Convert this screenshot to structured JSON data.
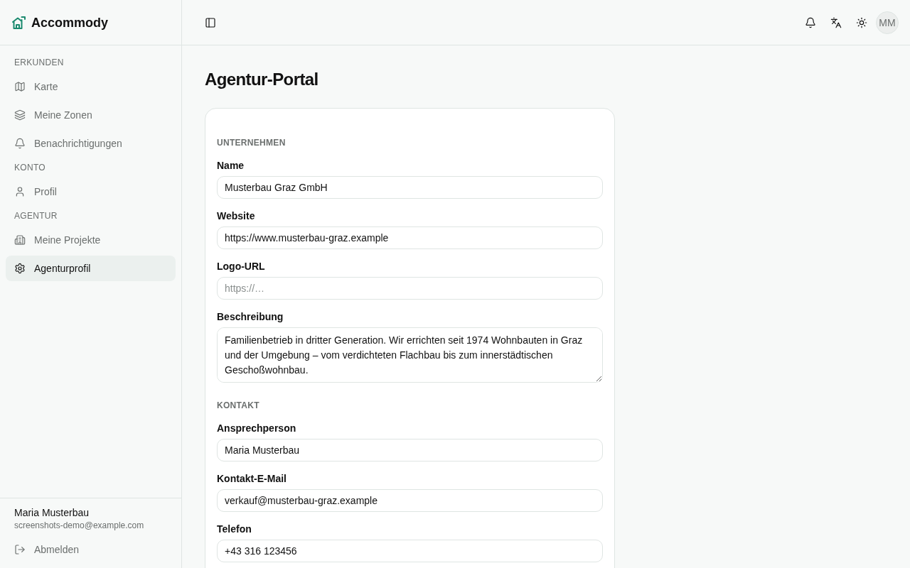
{
  "app": {
    "name": "Accommody"
  },
  "sidebar": {
    "sections": [
      {
        "title": "ERKUNDEN",
        "items": [
          {
            "label": "Karte",
            "selected": false
          },
          {
            "label": "Meine Zonen",
            "selected": false
          },
          {
            "label": "Benachrichtigungen",
            "selected": false
          }
        ]
      },
      {
        "title": "KONTO",
        "items": [
          {
            "label": "Profil",
            "selected": false
          }
        ]
      },
      {
        "title": "AGENTUR",
        "items": [
          {
            "label": "Meine Projekte",
            "selected": false
          },
          {
            "label": "Agenturprofil",
            "selected": true
          }
        ]
      }
    ],
    "user": {
      "name": "Maria Musterbau",
      "email": "screenshots-demo@example.com"
    },
    "logout": "Abmelden"
  },
  "header": {
    "avatar": "MM"
  },
  "page": {
    "title": "Agentur-Portal",
    "sections": [
      {
        "title": "UNTERNEHMEN",
        "fields": [
          {
            "kind": "input",
            "label": "Name",
            "value": "Musterbau Graz GmbH"
          },
          {
            "kind": "input",
            "label": "Website",
            "value": "https://www.musterbau-graz.example"
          },
          {
            "kind": "input",
            "label": "Logo-URL",
            "placeholder": "https://…"
          },
          {
            "kind": "textarea",
            "label": "Beschreibung",
            "value": "Familienbetrieb in dritter Generation. Wir errichten seit 1974 Wohnbauten in Graz und der Umgebung – vom verdichteten Flachbau bis zum innerstädtischen Geschoßwohnbau."
          }
        ]
      },
      {
        "title": "KONTAKT",
        "fields": [
          {
            "kind": "input",
            "label": "Ansprechperson",
            "value": "Maria Musterbau"
          },
          {
            "kind": "input",
            "label": "Kontakt-E-Mail",
            "value": "verkauf@musterbau-graz.example"
          },
          {
            "kind": "input",
            "label": "Telefon",
            "value": "+43 316 123456"
          }
        ]
      }
    ]
  }
}
